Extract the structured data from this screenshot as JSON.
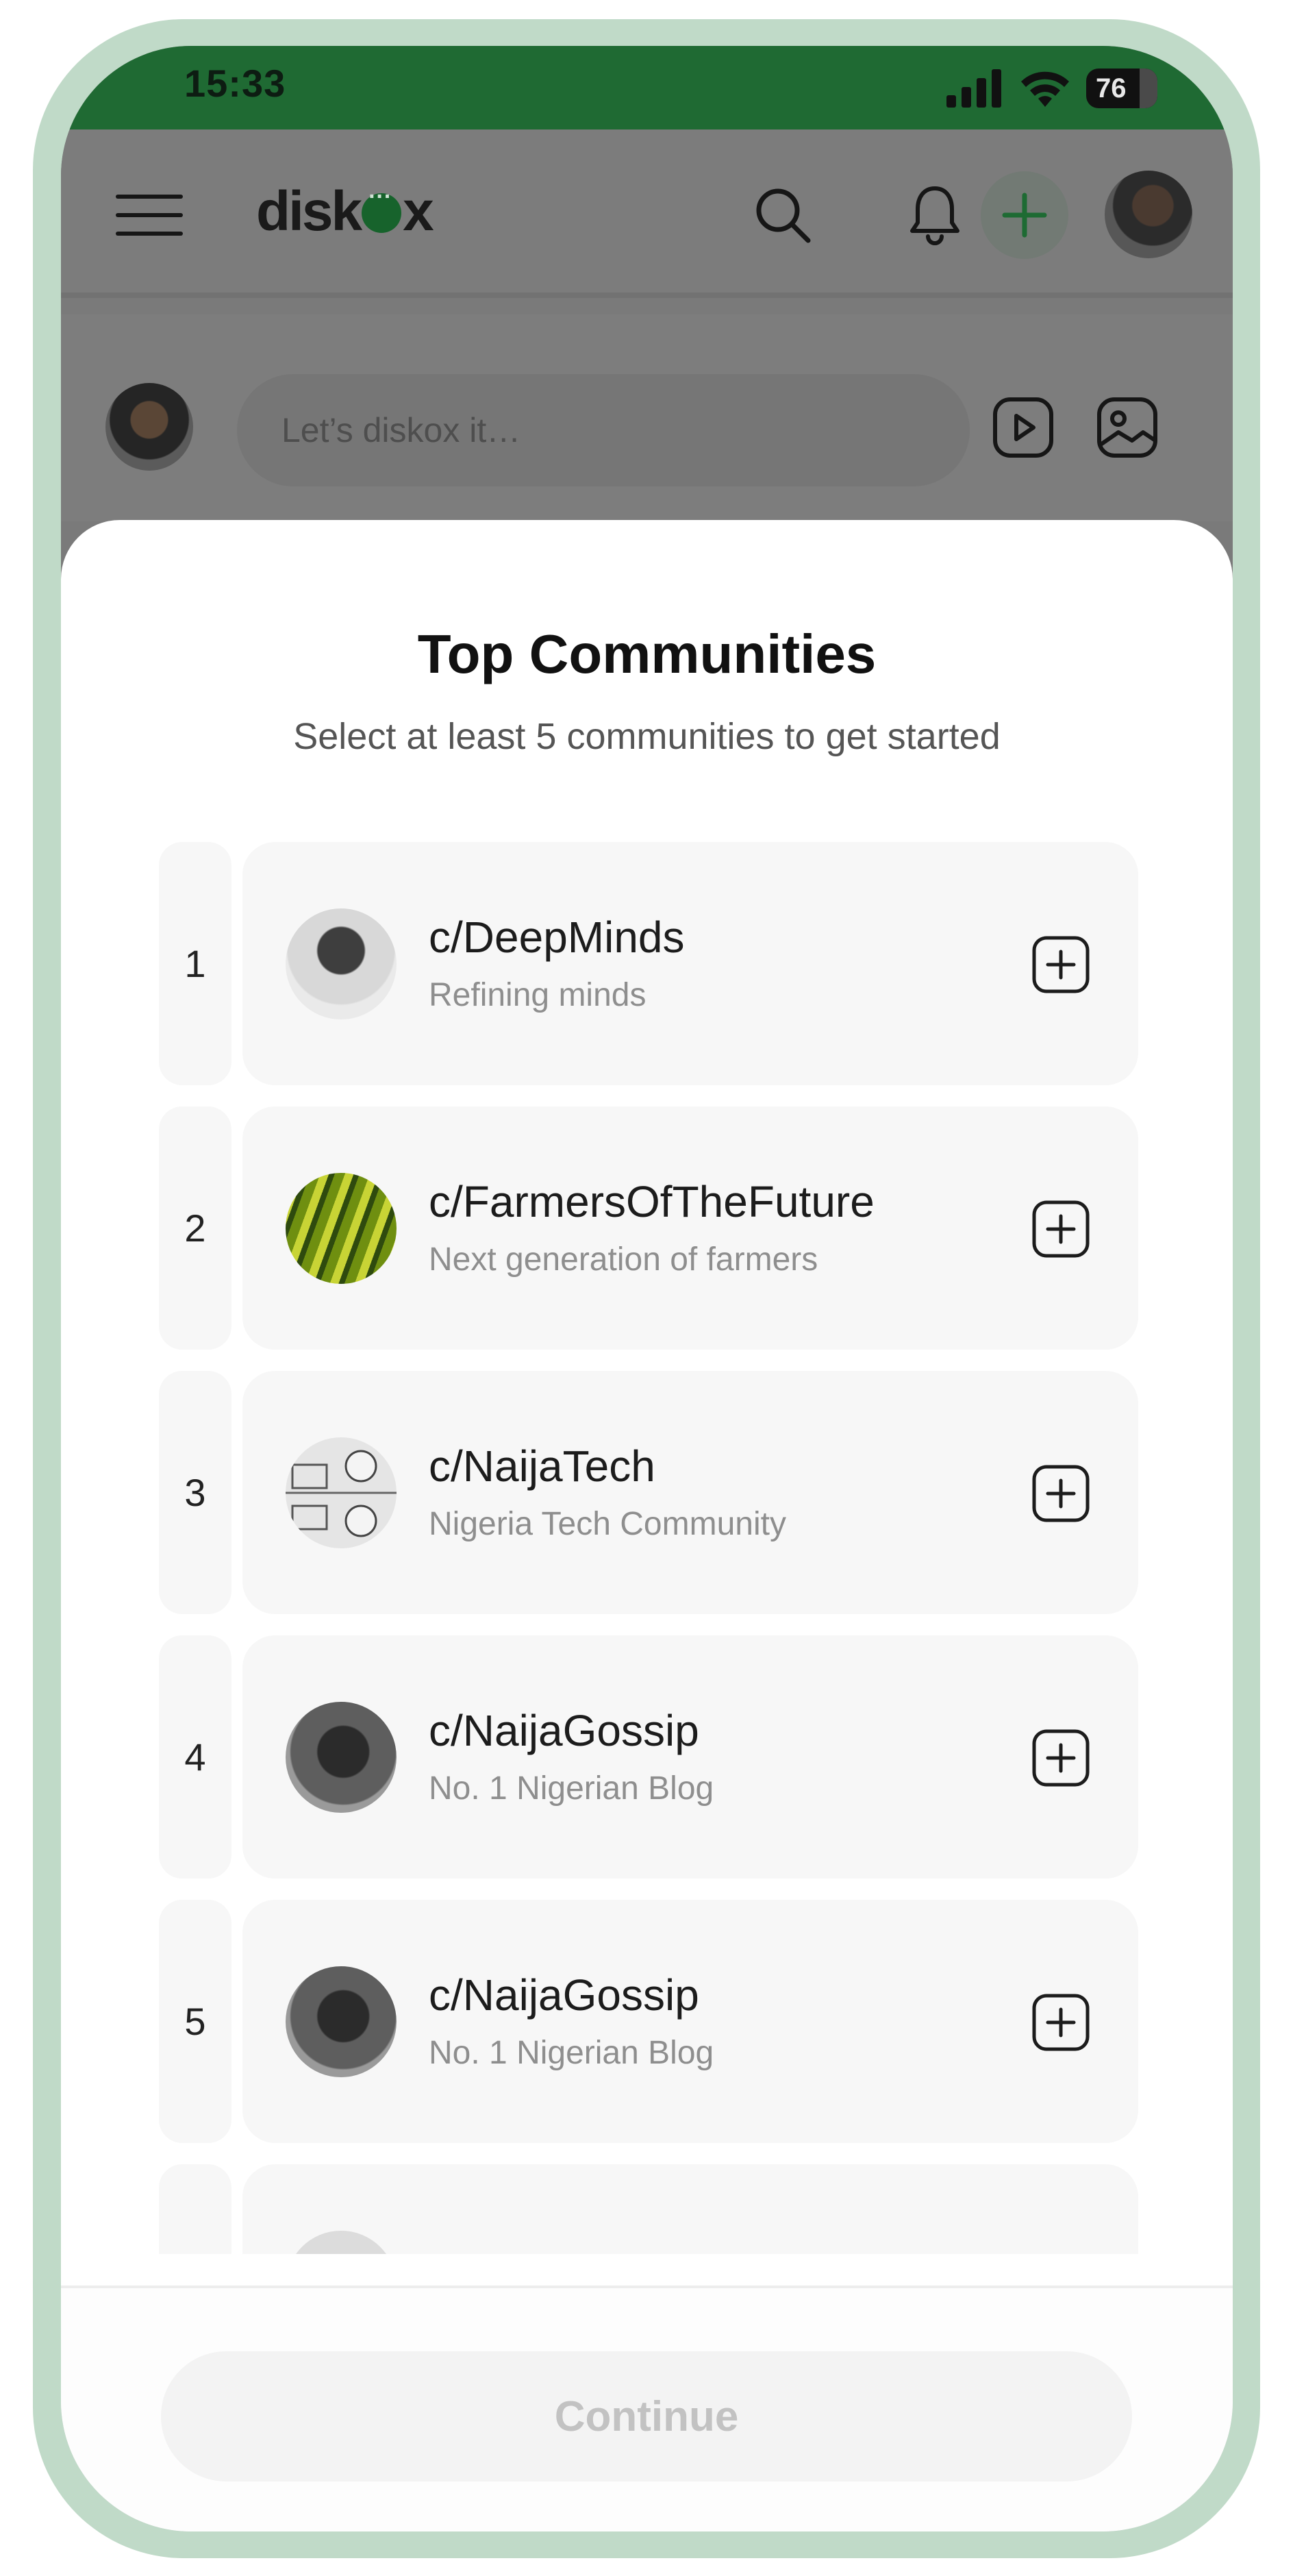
{
  "status_bar": {
    "time": "15:33",
    "battery": "76"
  },
  "header": {
    "logo_text_1": "disk",
    "logo_text_2": "x",
    "icons": [
      "menu-icon",
      "search-icon",
      "bell-icon",
      "plus-icon",
      "avatar"
    ]
  },
  "composer": {
    "placeholder": "Let’s diskox it…",
    "icons": [
      "video-icon",
      "image-icon"
    ]
  },
  "sheet": {
    "title": "Top Communities",
    "subtitle": "Select at least 5 communities to get started",
    "communities": [
      {
        "rank": "1",
        "name": "c/DeepMinds",
        "description": "Refining minds"
      },
      {
        "rank": "2",
        "name": "c/FarmersOfTheFuture",
        "description": "Next generation of farmers"
      },
      {
        "rank": "3",
        "name": "c/NaijaTech",
        "description": "Nigeria Tech Community"
      },
      {
        "rank": "4",
        "name": "c/NaijaGossip",
        "description": "No. 1 Nigerian Blog"
      },
      {
        "rank": "5",
        "name": "c/NaijaGossip",
        "description": "No. 1 Nigerian Blog"
      }
    ],
    "continue_label": "Continue"
  },
  "colors": {
    "status_bar": "#1f6a33",
    "frame": "#c0dac8",
    "brand_green": "#17632c"
  }
}
